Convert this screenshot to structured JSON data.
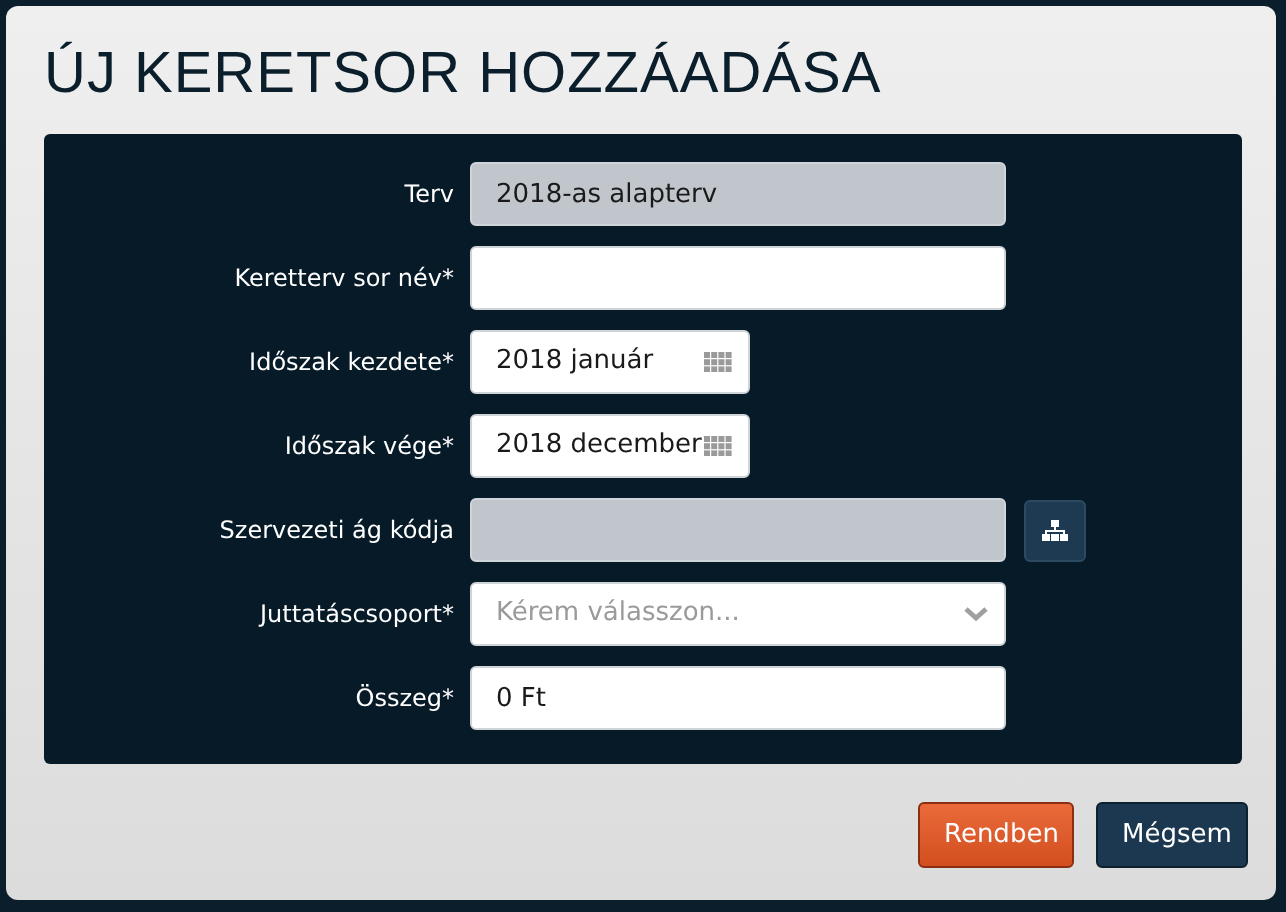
{
  "dialog": {
    "title": "ÚJ KERETSOR HOZZÁADÁSA"
  },
  "fields": [
    {
      "label": "Terv",
      "kind": "readonly",
      "value": "2018-as alapterv"
    },
    {
      "label": "Keretterv sor név*",
      "kind": "text"
    },
    {
      "label": "Időszak kezdete*",
      "kind": "date",
      "value": "2018 január"
    },
    {
      "label": "Időszak vége*",
      "kind": "date",
      "value": "2018 december"
    },
    {
      "label": "Szervezeti ág kódja",
      "kind": "lookup"
    },
    {
      "label": "Juttatáscsoport*",
      "kind": "select",
      "placeholder": "Kérem válasszon..."
    },
    {
      "label": "Összeg*",
      "kind": "text",
      "value": "0 Ft"
    }
  ],
  "buttons": [
    {
      "label": "Rendben",
      "kind": "primary"
    },
    {
      "label": "Mégsem",
      "kind": "secondary"
    }
  ]
}
